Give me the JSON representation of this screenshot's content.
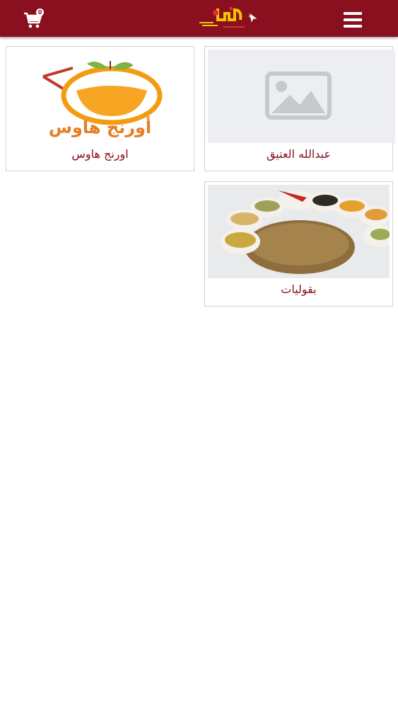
{
  "header": {
    "app_name": "app-logo",
    "cart_count": "0",
    "colors": {
      "bar": "#8a1020",
      "accent": "#f2c500"
    }
  },
  "cards": [
    {
      "label": "عبدالله العتيق",
      "image": "image-placeholder-icon"
    },
    {
      "label": "اورنج هاوس",
      "image": "orange-house-logo",
      "logo_text": "أورنج هاوس"
    },
    {
      "label": "بقوليات",
      "image": "spices-photo"
    }
  ]
}
